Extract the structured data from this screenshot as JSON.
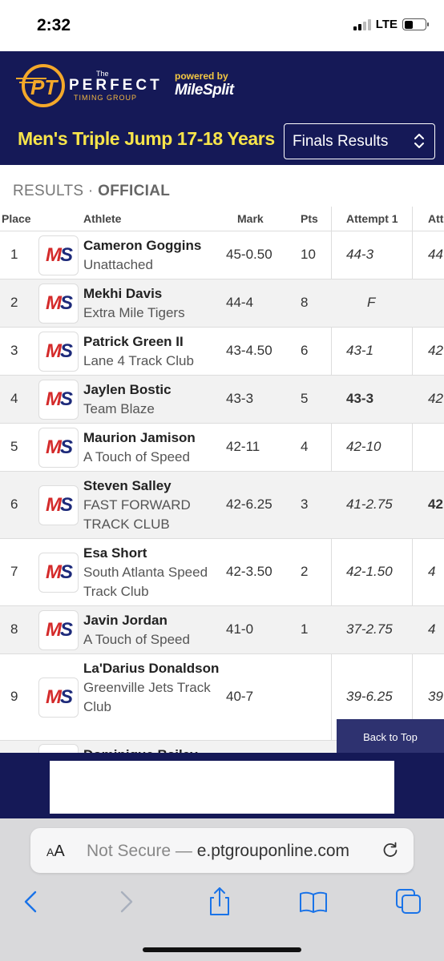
{
  "status_bar": {
    "time": "2:32",
    "network": "LTE"
  },
  "header": {
    "logo_the": "The",
    "logo_perfect": "PERFECT",
    "logo_timing": "TIMING GROUP",
    "powered_by": "powered by",
    "milesplit": "MileSplit",
    "event_title": "Men's Triple Jump 17-18 Years",
    "select_value": "Finals Results"
  },
  "results": {
    "label": "RESULTS",
    "separator": "·",
    "status": "OFFICIAL",
    "columns": {
      "place": "Place",
      "athlete": "Athlete",
      "mark": "Mark",
      "pts": "Pts",
      "attempt1": "Attempt 1",
      "attempt2": "Att"
    },
    "rows": [
      {
        "place": "1",
        "name": "Cameron Goggins",
        "team": "Unattached",
        "mark": "45-0.50",
        "pts": "10",
        "attempt1": "44-3",
        "attempt2": "44"
      },
      {
        "place": "2",
        "name": "Mekhi Davis",
        "team": "Extra Mile Tigers",
        "mark": "44-4",
        "pts": "8",
        "attempt1": "F",
        "attempt2": ""
      },
      {
        "place": "3",
        "name": "Patrick Green II",
        "team": "Lane 4 Track Club",
        "mark": "43-4.50",
        "pts": "6",
        "attempt1": "43-1",
        "attempt2": "42"
      },
      {
        "place": "4",
        "name": "Jaylen Bostic",
        "team": "Team Blaze",
        "mark": "43-3",
        "pts": "5",
        "attempt1": "43-3",
        "attempt2": "42"
      },
      {
        "place": "5",
        "name": "Maurion Jamison",
        "team": "A Touch of Speed",
        "mark": "42-11",
        "pts": "4",
        "attempt1": "42-10",
        "attempt2": ""
      },
      {
        "place": "6",
        "name": "Steven Salley",
        "team": "FAST FORWARD TRACK CLUB",
        "mark": "42-6.25",
        "pts": "3",
        "attempt1": "41-2.75",
        "attempt2": "42"
      },
      {
        "place": "7",
        "name": "Esa Short",
        "team": "South Atlanta Speed Track Club",
        "mark": "42-3.50",
        "pts": "2",
        "attempt1": "42-1.50",
        "attempt2": "4"
      },
      {
        "place": "8",
        "name": "Javin Jordan",
        "team": "A Touch of Speed",
        "mark": "41-0",
        "pts": "1",
        "attempt1": "37-2.75",
        "attempt2": "4"
      },
      {
        "place": "9",
        "name": "La'Darius Donaldson",
        "team": "Greenville Jets Track Club",
        "mark": "40-7",
        "pts": "",
        "attempt1": "39-6.25",
        "attempt2": "39"
      },
      {
        "place": "",
        "name": "Dominique Bailey",
        "team": "",
        "mark": "",
        "pts": "",
        "attempt1": "",
        "attempt2": ""
      }
    ],
    "ms_m": "M",
    "ms_s": "S",
    "back_to_top": "Back to Top"
  },
  "browser": {
    "aa_small": "A",
    "aa_large": "A",
    "url_prefix": "Not Secure — ",
    "url_domain": "e.ptgrouponline.com"
  },
  "colors": {
    "header_bg": "#151957",
    "title_yellow": "#f7e44a",
    "brand_red": "#d42a2a",
    "brand_navy": "#1d2a7a",
    "ios_blue": "#1a73e8"
  }
}
